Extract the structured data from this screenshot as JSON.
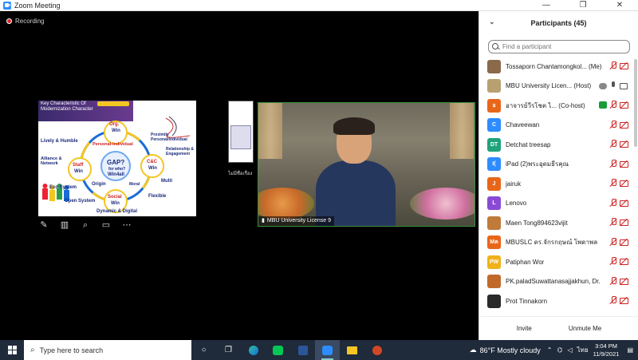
{
  "window": {
    "title": "Zoom Meeting",
    "controls": [
      "—",
      "❐",
      "✕"
    ]
  },
  "recording": {
    "label": "Recording"
  },
  "shared_slide": {
    "title": "Key Characteristic Of Modernization Character",
    "nodes": {
      "center": "GAP?",
      "center_sub": "for who?",
      "center_win": "Win4all",
      "org": "Org.",
      "org_win": "Win",
      "cc": "C&C",
      "cc_win": "Win",
      "social": "Social",
      "social_win": "Win",
      "staff": "Staff",
      "staff_win": "Win"
    },
    "labels": {
      "personal": "Personal-Individual",
      "lively": "Lively & Humble",
      "proximity": "Proximity Personal/Individual",
      "relationship": "Relationship & Engagement",
      "alliance": "Alliance & Network",
      "eco": "Eco System",
      "open": "Open System",
      "origin": "Origin",
      "moral": "Moral",
      "multi": "Multi",
      "flexible": "Flexible",
      "dynamic": "Dynamic & Digital"
    }
  },
  "share_tools": [
    "pen-icon",
    "annotate-icon",
    "zoom-icon",
    "screen-icon",
    "more-icon"
  ],
  "thumbnail": {
    "label": "ไม่มีชื่อเรื่อง"
  },
  "video": {
    "name": "MBU University License 9"
  },
  "participants": {
    "header": "Participants (45)",
    "search_placeholder": "Find a participant",
    "rows": [
      {
        "initials": "",
        "name": "Tossaporn Chantamongkol... (Me)",
        "color": "#8a6a4a",
        "mic": "off",
        "video": "off",
        "extra": ""
      },
      {
        "initials": "",
        "name": "MBU University Licen... (Host)",
        "color": "#b8a070",
        "mic": "on",
        "video": "on",
        "extra": "cloud"
      },
      {
        "initials": "อ",
        "name": "อาจารย์วีรโชต ไ... (Co-host)",
        "color": "#e8661a",
        "mic": "off",
        "video": "off",
        "extra": "share"
      },
      {
        "initials": "C",
        "name": "Chaveewan",
        "color": "#2d8cff",
        "mic": "off",
        "video": "off",
        "extra": ""
      },
      {
        "initials": "DT",
        "name": "Detchat treesap",
        "color": "#1fa37a",
        "mic": "off",
        "video": "off",
        "extra": ""
      },
      {
        "initials": "I(",
        "name": "iPad (2)พระอุดมธีรคุณ",
        "color": "#2d8cff",
        "mic": "off",
        "video": "off",
        "extra": ""
      },
      {
        "initials": "J",
        "name": "jairuk",
        "color": "#e8661a",
        "mic": "off",
        "video": "off",
        "extra": ""
      },
      {
        "initials": "L",
        "name": "Lenovo",
        "color": "#8a4ad6",
        "mic": "off",
        "video": "off",
        "extra": ""
      },
      {
        "initials": "",
        "name": "Maen Tong894623vijit",
        "color": "#c07a3a",
        "mic": "off",
        "video": "off",
        "extra": ""
      },
      {
        "initials": "Mค",
        "name": "MBUSLC ดร.จักรกฤษณ์ โพดาพล",
        "color": "#e8661a",
        "mic": "off",
        "video": "off",
        "extra": ""
      },
      {
        "initials": "PW",
        "name": "Patiphan Wor",
        "color": "#f0b21a",
        "mic": "off",
        "video": "off",
        "extra": ""
      },
      {
        "initials": "",
        "name": "PK.paladSuwattanasajjakhun, Dr.",
        "color": "#c06a2a",
        "mic": "off",
        "video": "off",
        "extra": ""
      },
      {
        "initials": "",
        "name": "Prot Tinnakorn",
        "color": "#2a2a2a",
        "mic": "off",
        "video": "off",
        "extra": ""
      }
    ],
    "invite_label": "Invite",
    "unmute_label": "Unmute Me"
  },
  "taskbar": {
    "search_placeholder": "Type here to search",
    "apps": [
      "task-view-icon",
      "edge-icon",
      "line-icon",
      "word-icon",
      "zoom-icon",
      "explorer-icon",
      "powerpoint-icon"
    ],
    "weather": "86°F  Mostly cloudy",
    "lang": "ไทย",
    "time": "3:04 PM",
    "date": "11/9/2021"
  }
}
